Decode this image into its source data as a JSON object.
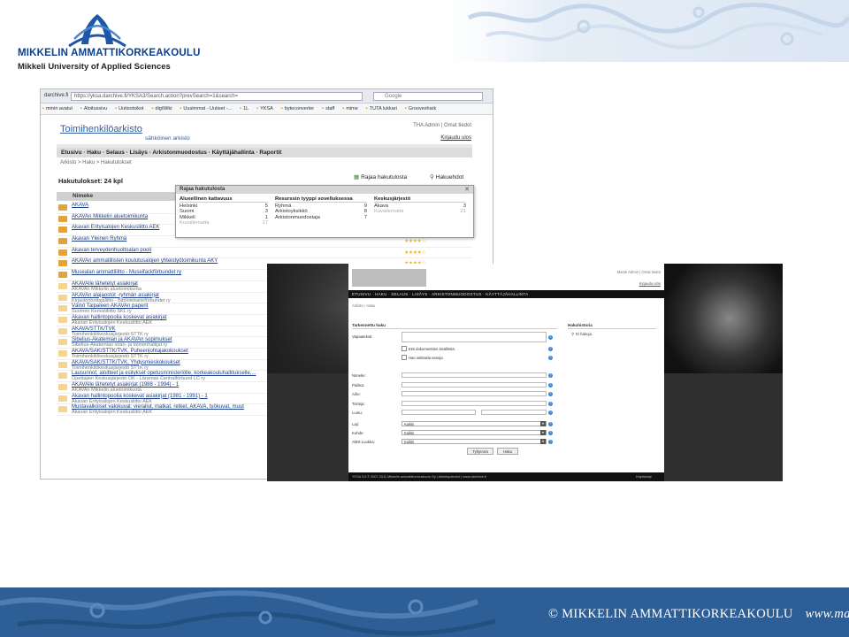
{
  "logo": {
    "name": "MIKKELIN AMMATTIKORKEAKOULU",
    "sub": "Mikkeli University of Applied Sciences"
  },
  "browser": {
    "tab": "darchive.fi",
    "url": "https://yksa.darchive.fi/YKSA3/Search.action?prevSearch=1&search=",
    "search_placeholder": "Google",
    "bookmarks": [
      "mmin avatut",
      "Aloitussivu",
      "Uutisotsikot",
      "digiWiki",
      "Uusimmat - Uutiset -...",
      "1L",
      "YKSA",
      "byteconverter",
      "staff",
      "mime",
      "TUTA lukkari",
      "Grooveshark"
    ]
  },
  "archive": {
    "title": "Toimihenkilöarkisto",
    "subtitle": "sähköinen arkisto",
    "user": "THA Admin | Omat tiedot",
    "logout": "Kirjaudu ulos",
    "page_number": "1",
    "nav": "Etusivu · Haku · Selaus · Lisäys · Arkistonmuodostus · Käyttäjähallinta · Raportit",
    "breadcrumb": "Arkisto > Haku > Hakutulokset",
    "results_title": "Hakutulokset: 24 kpl",
    "refine_label": "Rajaa hakutulosta",
    "criteria_label": "Hakuehdot",
    "column_header": "Nimeke",
    "rows": [
      {
        "title": "AKAVA",
        "sub": ""
      },
      {
        "title": "AKAVAn Mikkelin aluetoimikunta",
        "sub": ""
      },
      {
        "title": "Akavan Erityisalojen Keskusliitto AEK",
        "sub": ""
      },
      {
        "title": "Akavan Yleinen Ryhmä",
        "sub": ""
      },
      {
        "title": "Akavan terveydenhuoltoalan pooli",
        "sub": ""
      },
      {
        "title": "AKAVAn ammatillisten koulutusalojen yhteistyötoimikunta AKY",
        "sub": ""
      },
      {
        "title": "Musealan ammattiliitto - Museifackförbundet ry",
        "sub": ""
      },
      {
        "title": "AKAVAlle lähetetyt asiakirjat",
        "sub": "AKAVAn Mikkelin aluetoimikunta"
      },
      {
        "title": "AKAVAn alajaostot -ryhmän asiakirjat",
        "sub": "Kirjastonhoitajaliitto - Bibliotekarieförbundet ry"
      },
      {
        "title": "Väinö Taipaleen AKAVAn paperit",
        "sub": "Suomen Kemistiliitto SKL ry"
      },
      {
        "title": "Akavan hallintopoolia koskevat asiakirjat",
        "sub": "Akavan Erityisalojen Keskusliitto AEK"
      },
      {
        "title": "AKAVA/STTK/TVK",
        "sub": "Toimihenkilökeskusjärjestö STTK ry"
      },
      {
        "title": "Sibelius-Akatemian ja AKAVAn sopimukset",
        "sub": "Sibelius-Akatemian viran- ja toimenhaltijat ry"
      },
      {
        "title": "AKAVA/SAK/STTK/TVK, Puheenjohtajakokoukset",
        "sub": "Toimihenkilökeskusjärjestö STTK ry"
      },
      {
        "title": "AKAVA/SAK/STTK/TVK, Yhdysmieskokoukset",
        "sub": "Toimihenkilökeskusjärjestö STTK ry"
      },
      {
        "title": "Lausunnot, aloitteet ja esitykset opetusministeriölle, korkeakouluhallitukselle,...",
        "sub": "Opettajien Keskusjärjestö OK - Lärarnas Centralförbund LC ry"
      },
      {
        "title": "AKAVAlle lähetetyt asiakirjat (1988 - 1994) - 1",
        "sub": "AKAVAn Mikkelin aluetoimikunta"
      },
      {
        "title": "Akavan hallintopoolia koskevat asiakirjat (1981 - 1991) - 1",
        "sub": "Akavan Erityisalojen Keskusliitto AEK"
      },
      {
        "title": "Mustavalkoiset valokuvat: vierailut, matkat, retket, AKAVA, työkuvat, muut",
        "sub": "Akavan Erityisalojen Keskusliitto AEK"
      }
    ],
    "stars": "★★★★☆"
  },
  "popup": {
    "title": "Rajaa hakutulosta",
    "close": "✕",
    "cols": [
      {
        "header": "Alueellinen kattavuus",
        "items": [
          {
            "label": "Helsinki",
            "count": "5"
          },
          {
            "label": "Suomi",
            "count": "3"
          },
          {
            "label": "Mikkeli",
            "count": "1"
          },
          {
            "label": "Kuvailematta",
            "count": "17",
            "muted": true
          }
        ]
      },
      {
        "header": "Resurssin tyyppi sovelluksessa",
        "items": [
          {
            "label": "Ryhmä",
            "count": "9"
          },
          {
            "label": "Arkistoyksikkö",
            "count": "8"
          },
          {
            "label": "Arkistonmuodostaja",
            "count": "7"
          }
        ]
      },
      {
        "header": "Keskusjärjestö",
        "items": [
          {
            "label": "Akava",
            "count": "3"
          },
          {
            "label": "Kuvailematta",
            "count": "21",
            "muted": true
          }
        ]
      }
    ]
  },
  "search_page": {
    "user": "Mamk Admin | Omat tiedot",
    "logout": "Kirjaudu ulos",
    "nav": "ETUSIVU · HAKU · SELAUS · LISÄYS · ARKISTONMUODOSTUS · KÄYTTÄJÄHALLINTA",
    "breadcrumb": "Arkisto › Haku",
    "left_title": "Tarkennettu haku",
    "right_title": "Hakuhistoria",
    "no_history": "Ei hakuja.",
    "free_text_label": "Vapaateksti:",
    "check1": "Etsi dokumenttien sisällöstä.",
    "check2": "Hae osittaisia sanoja.",
    "fields": [
      "Nimeke:",
      "Paikka:",
      "Aihe:",
      "Toimija:",
      "Luotu:"
    ],
    "selects": [
      {
        "label": "Laji:",
        "value": "Kaikki"
      },
      {
        "label": "Kohde:",
        "value": "Kaikki"
      },
      {
        "label": "AMS-Luokka:",
        "value": "Kaikki"
      }
    ],
    "clear_button": "Tyhjennä",
    "search_button": "Haku",
    "footer": "YKSA 3.0 © 2007-2011 Mikkelin ammattikorkeakoulu Oy | Arkistopalvelut | www.darchive.fi",
    "footer_right": "Käyttöohje"
  },
  "footer": {
    "org": "© MIKKELIN AMMATTIKORKEAKOULU",
    "web": "www.mamk.fi"
  }
}
